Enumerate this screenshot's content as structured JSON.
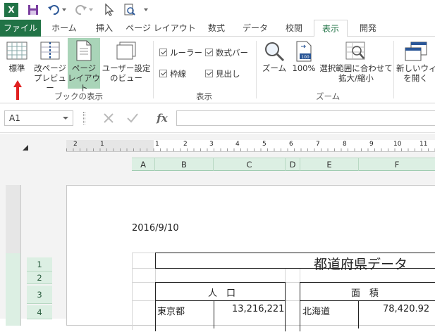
{
  "qat": {
    "excel_icon": "excel-logo-icon",
    "save_icon": "save-icon",
    "undo_icon": "undo-icon",
    "redo_icon": "redo-icon",
    "cursor_icon": "select-cursor-icon",
    "preview_icon": "print-preview-icon",
    "customize_icon": "customize-qat-icon"
  },
  "tabs": [
    "ファイル",
    "ホーム",
    "挿入",
    "ページ レイアウト",
    "数式",
    "データ",
    "校閲",
    "表示",
    "開発"
  ],
  "ribbon": {
    "views": {
      "normal": "標準",
      "page_break_1": "改ページ",
      "page_break_2": "プレビュー",
      "page_layout_1": "ページ",
      "page_layout_2": "レイアウト",
      "custom_1": "ユーザー設定",
      "custom_2": "のビュー",
      "group": "ブックの表示"
    },
    "show": {
      "ruler": "ルーラー",
      "formula_bar": "数式バー",
      "gridlines": "枠線",
      "headings": "見出し",
      "group": "表示"
    },
    "zoom": {
      "zoom": "ズーム",
      "hundred": "100%",
      "fit_1": "選択範囲に合わせて",
      "fit_2": "拡大/縮小",
      "group": "ズーム"
    },
    "window": {
      "new_1": "新しいウィン",
      "new_2": "を開く"
    }
  },
  "formula_bar": {
    "name_box": "A1",
    "cancel_icon": "cancel-x-icon",
    "enter_icon": "enter-check-icon",
    "fx": "fx"
  },
  "ruler_numbers": [
    "2",
    "1",
    "1",
    "2",
    "3",
    "4",
    "5",
    "6",
    "7",
    "8",
    "9",
    "10",
    "11"
  ],
  "columns": [
    "A",
    "B",
    "C",
    "D",
    "E",
    "F"
  ],
  "rows": [
    "1",
    "2",
    "3",
    "4"
  ],
  "sheet": {
    "date": "2016/9/10",
    "title": "都道府県データ",
    "pop_header": "人　口",
    "area_header": "面　積",
    "pref1": "東京都",
    "pop1": "13,216,221",
    "pref2": "北海道",
    "area1": "78,420.92"
  },
  "colors": {
    "excel_green": "#217346",
    "selected_button": "#a9d4b8",
    "header_green": "#dcefe3",
    "arrow_red": "#e02020"
  }
}
